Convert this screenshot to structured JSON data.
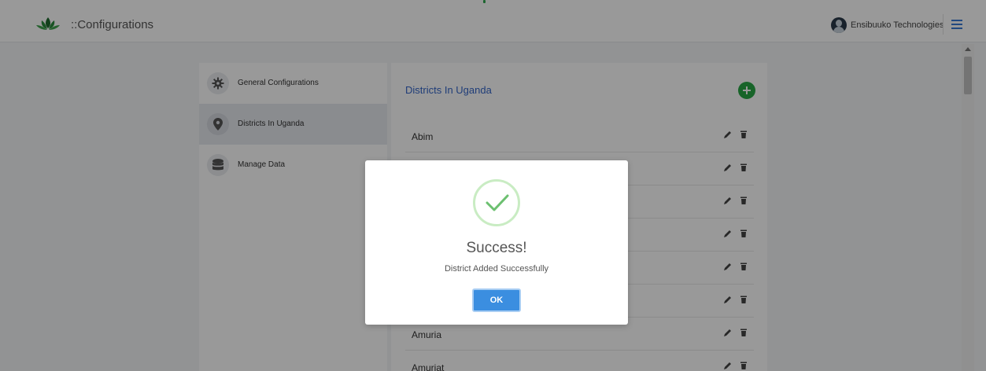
{
  "header": {
    "app_title": "::Configurations",
    "user_name": "Ensibuuko Technologies",
    "logo_icon": "lotus-logo-icon",
    "menu_icon": "hamburger-menu-icon"
  },
  "sidebar": {
    "items": [
      {
        "label": "General Configurations",
        "icon": "gear-icon",
        "active": false
      },
      {
        "label": "Districts In Uganda",
        "icon": "map-pin-icon",
        "active": true
      },
      {
        "label": "Manage Data",
        "icon": "database-icon",
        "active": false
      }
    ]
  },
  "panel": {
    "title": "Districts In Uganda",
    "add_icon": "plus-icon",
    "districts": [
      "Abim",
      "",
      "",
      "",
      "",
      "",
      "Amuria",
      "Amuriat"
    ]
  },
  "modal": {
    "title": "Success!",
    "message": "District Added Successfully",
    "ok_label": "OK",
    "icon": "checkmark-icon"
  },
  "colors": {
    "accent_blue": "#3566c9",
    "add_green": "#28a745",
    "ok_blue": "#3b8ee0",
    "check_green": "#5cb85c"
  }
}
